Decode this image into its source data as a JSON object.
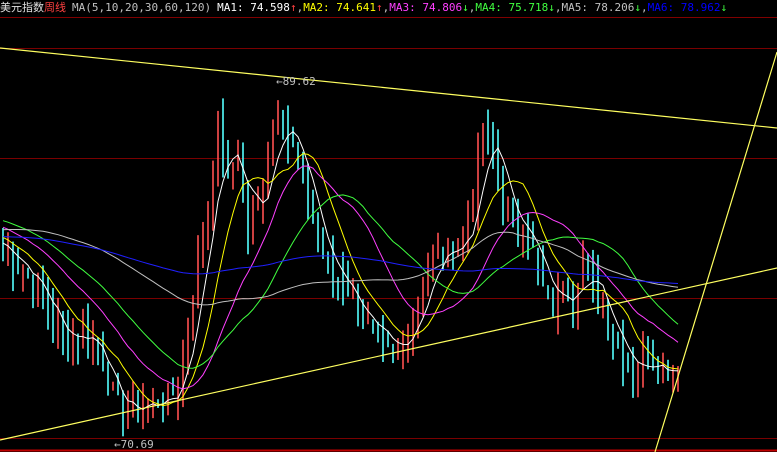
{
  "header": {
    "title": "美元指数",
    "period": "周线",
    "ma_label": "MA(5,10,20,30,60,120)",
    "ma_values": [
      {
        "name": "MA1",
        "value": "74.598",
        "arrow": "↑",
        "color": "#ffffff",
        "arrow_color": "#ff4040"
      },
      {
        "name": "MA2",
        "value": "74.641",
        "arrow": "↑",
        "color": "#ffff00",
        "arrow_color": "#ff4040"
      },
      {
        "name": "MA3",
        "value": "74.806",
        "arrow": "↓",
        "color": "#ff40ff",
        "arrow_color": "#40ff40"
      },
      {
        "name": "MA4",
        "value": "75.718",
        "arrow": "↓",
        "color": "#40ff40",
        "arrow_color": "#40ff40"
      },
      {
        "name": "MA5",
        "value": "78.206",
        "arrow": "↓",
        "color": "#c0c0c0",
        "arrow_color": "#40ff40"
      },
      {
        "name": "MA6",
        "value": "78.962",
        "arrow": "↓",
        "color": "#0000ff",
        "arrow_color": "#40ff40"
      }
    ]
  },
  "chart_data": {
    "type": "candlestick",
    "title": "美元指数 周线",
    "ma_periods": [
      5,
      10,
      20,
      30,
      60,
      120
    ],
    "ma_colors": [
      "#ffffff",
      "#ffff00",
      "#ff40ff",
      "#40ff40",
      "#c0c0c0",
      "#2020ff"
    ],
    "up_color": "#ff5050",
    "down_color": "#54ffff",
    "ylim": [
      69.9,
      92.1
    ],
    "annotations": [
      {
        "text": "89.62",
        "type": "high",
        "price": 89.62
      },
      {
        "text": "70.69",
        "type": "low",
        "price": 70.69
      }
    ],
    "close_keypoints": [
      [
        0,
        80.68
      ],
      [
        4,
        79.89
      ],
      [
        8,
        78.05
      ],
      [
        12,
        75.95
      ],
      [
        16,
        76.47
      ],
      [
        20,
        74.9
      ],
      [
        22,
        72.79
      ],
      [
        24,
        72.26
      ],
      [
        28,
        72.53
      ],
      [
        32,
        72.79
      ],
      [
        35,
        73.32
      ],
      [
        37,
        77.0
      ],
      [
        40,
        81.21
      ],
      [
        43,
        86.99
      ],
      [
        45,
        84.36
      ],
      [
        47,
        85.94
      ],
      [
        49,
        81.73
      ],
      [
        51,
        83.31
      ],
      [
        53,
        85.41
      ],
      [
        55,
        88.57
      ],
      [
        57,
        86.47
      ],
      [
        59,
        85.41
      ],
      [
        61,
        83.31
      ],
      [
        63,
        81.21
      ],
      [
        65,
        79.63
      ],
      [
        68,
        79.1
      ],
      [
        70,
        78.05
      ],
      [
        72,
        77.0
      ],
      [
        75,
        75.95
      ],
      [
        78,
        74.9
      ],
      [
        80,
        75.95
      ],
      [
        83,
        78.05
      ],
      [
        86,
        80.16
      ],
      [
        89,
        80.68
      ],
      [
        92,
        81.21
      ],
      [
        94,
        83.31
      ],
      [
        96,
        86.99
      ],
      [
        98,
        85.94
      ],
      [
        100,
        83.31
      ],
      [
        102,
        81.73
      ],
      [
        104,
        82.26
      ],
      [
        106,
        80.68
      ],
      [
        108,
        78.58
      ],
      [
        110,
        77.53
      ],
      [
        112,
        79.1
      ],
      [
        114,
        78.05
      ],
      [
        116,
        80.16
      ],
      [
        118,
        78.58
      ],
      [
        120,
        77.53
      ],
      [
        122,
        76.47
      ],
      [
        124,
        75.42
      ],
      [
        126,
        74.37
      ],
      [
        128,
        74.9
      ],
      [
        130,
        74.9
      ],
      [
        132,
        74.63
      ],
      [
        134,
        74.37
      ],
      [
        135,
        74.9
      ]
    ]
  }
}
